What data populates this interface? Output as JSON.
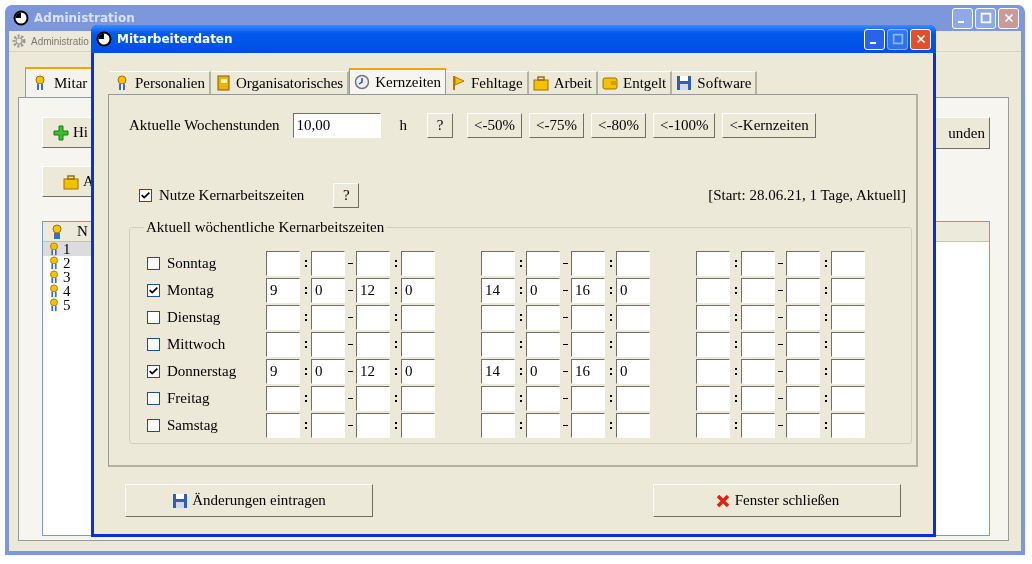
{
  "main_window": {
    "title": "Administration",
    "menu_label": "Administratio",
    "tabs": [
      {
        "label": "Mitar",
        "selected": true
      }
    ],
    "buttons": [
      {
        "label": "Hi"
      },
      {
        "label": "A"
      }
    ],
    "right_button": "unden",
    "list": {
      "header": "N",
      "rows": [
        {
          "label": "1",
          "selected": true
        },
        {
          "label": "2",
          "selected": false
        },
        {
          "label": "3",
          "selected": false
        },
        {
          "label": "4",
          "selected": false
        },
        {
          "label": "5",
          "selected": false
        }
      ]
    }
  },
  "dialog": {
    "title": "Mitarbeiterdaten",
    "maximize_disabled": true,
    "tabs": [
      {
        "label": "Personalien",
        "selected": false
      },
      {
        "label": "Organisatorisches",
        "selected": false
      },
      {
        "label": "Kernzeiten",
        "selected": true
      },
      {
        "label": "Fehltage",
        "selected": false
      },
      {
        "label": "Arbeit",
        "selected": false
      },
      {
        "label": "Entgelt",
        "selected": false
      },
      {
        "label": "Software",
        "selected": false
      }
    ],
    "weekly_hours": {
      "label": "Aktuelle Wochenstunden",
      "value": "10,00",
      "unit": "h",
      "help": "?"
    },
    "presets": [
      "<-50%",
      "<-75%",
      "<-80%",
      "<-100%",
      "<-Kernzeiten"
    ],
    "use_core_hours": {
      "label": "Nutze Kernarbeitszeiten",
      "checked": true,
      "help": "?"
    },
    "status": "[Start: 28.06.21, 1 Tage, Aktuell]",
    "group_title": "Aktuell wöchentliche Kernarbeitszeiten",
    "days": [
      {
        "name": "Sonntag",
        "checked": false
      },
      {
        "name": "Montag",
        "checked": true,
        "slots": [
          {
            "start_hour": "9",
            "start_minute": "0",
            "end_hour": "12",
            "end_minute": "0"
          },
          {
            "start_hour": "14",
            "start_minute": "0",
            "end_hour": "16",
            "end_minute": "0"
          }
        ]
      },
      {
        "name": "Dienstag",
        "checked": false
      },
      {
        "name": "Mittwoch",
        "checked": false
      },
      {
        "name": "Donnerstag",
        "checked": true,
        "slots": [
          {
            "start_hour": "9",
            "start_minute": "0",
            "end_hour": "12",
            "end_minute": "0"
          },
          {
            "start_hour": "14",
            "start_minute": "0",
            "end_hour": "16",
            "end_minute": "0"
          }
        ]
      },
      {
        "name": "Freitag",
        "checked": false
      },
      {
        "name": "Samstag",
        "checked": false
      }
    ],
    "save_button": "Änderungen eintragen",
    "close_button": "Fenster schließen"
  }
}
